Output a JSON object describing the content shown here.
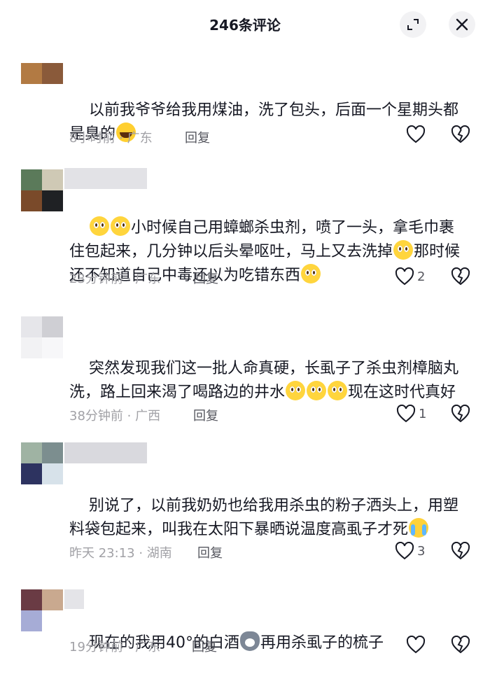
{
  "header": {
    "title": "246条评论"
  },
  "actions": {
    "reply_label": "回复"
  },
  "colors": {
    "icon": "#161823",
    "meta": "#a1a1a6",
    "text": "#161823"
  },
  "comments": [
    {
      "text_a": "以前我爷爷给我用煤油，洗了包头，后面一个星期头都是臭的",
      "emojis": [
        "lol"
      ],
      "time_loc": "8小时前 · 广东",
      "likes": ""
    },
    {
      "text_a": "小时候自己用蟑螂杀虫剂，喷了一头，拿毛巾裹住包起来，几分钟以后头晕呕吐，马上又去洗掉",
      "text_b": "那时候还不知道自己中毒还以为吃错东西",
      "emojis": [
        "pleading-face",
        "pleading-face",
        "pleading-face",
        "pleading-face"
      ],
      "time_loc": "23分钟前 · 广东",
      "likes": "2"
    },
    {
      "text_a": "突然发现我们这一批人命真硬，长虱子了杀虫剂樟脑丸洗，路上回来渴了喝路边的井水",
      "text_b": "现在这时代真好",
      "emojis": [
        "pleading-face",
        "pleading-face",
        "pleading-face"
      ],
      "time_loc": "38分钟前 · 广西",
      "likes": "1"
    },
    {
      "text_a": "别说了，以前我奶奶也给我用杀虫的粉子洒头上，用塑料袋包起来，叫我在太阳下暴晒说温度高虱子才死",
      "emojis": [
        "crying-face"
      ],
      "time_loc": "昨天 23:13 · 湖南",
      "likes": "3"
    },
    {
      "text_a": "现在的我用40°的白酒",
      "text_b": "再用杀虱子的梳子",
      "emojis": [
        "cat-face"
      ],
      "time_loc": "19分钟前 · 广东",
      "likes": ""
    }
  ]
}
